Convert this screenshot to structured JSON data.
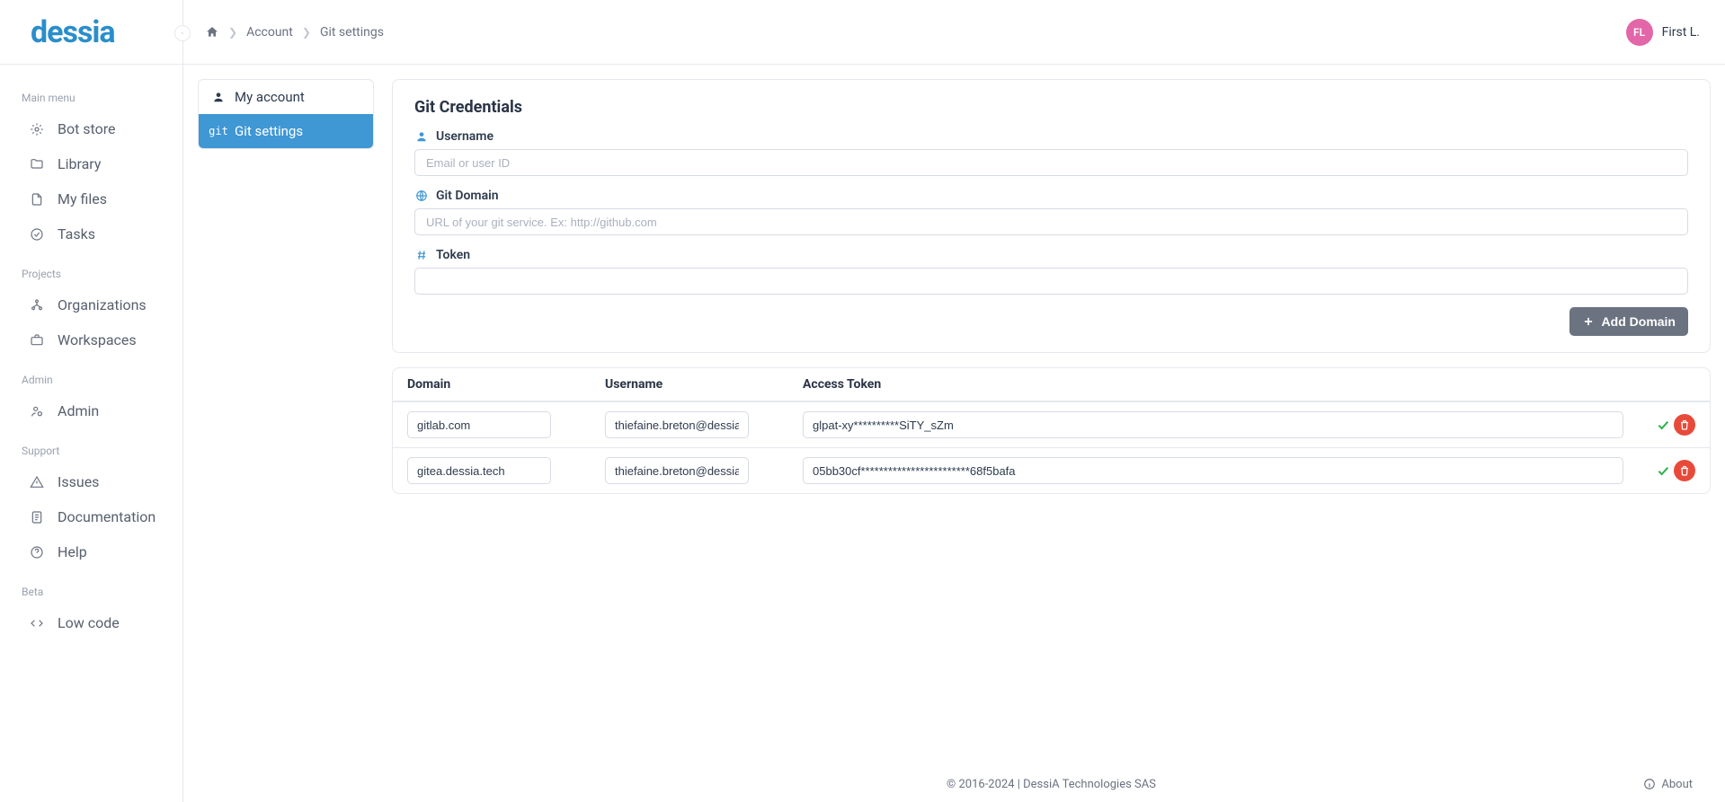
{
  "logo": "dessia",
  "breadcrumb": {
    "home_aria": "Home",
    "account": "Account",
    "git": "Git settings"
  },
  "user": {
    "initials": "FL",
    "display": "First L."
  },
  "sidebar": {
    "sections": [
      {
        "label": "Main menu",
        "items": [
          {
            "name": "bot-store",
            "label": "Bot store"
          },
          {
            "name": "library",
            "label": "Library"
          },
          {
            "name": "my-files",
            "label": "My files"
          },
          {
            "name": "tasks",
            "label": "Tasks"
          }
        ]
      },
      {
        "label": "Projects",
        "items": [
          {
            "name": "organizations",
            "label": "Organizations"
          },
          {
            "name": "workspaces",
            "label": "Workspaces"
          }
        ]
      },
      {
        "label": "Admin",
        "items": [
          {
            "name": "admin",
            "label": "Admin"
          }
        ]
      },
      {
        "label": "Support",
        "items": [
          {
            "name": "issues",
            "label": "Issues"
          },
          {
            "name": "documentation",
            "label": "Documentation"
          },
          {
            "name": "help",
            "label": "Help"
          }
        ]
      },
      {
        "label": "Beta",
        "items": [
          {
            "name": "low-code",
            "label": "Low code"
          }
        ]
      }
    ]
  },
  "settings_tabs": {
    "account": "My account",
    "git_prefix": "git",
    "git": "Git settings"
  },
  "form": {
    "title": "Git Credentials",
    "username_label": "Username",
    "username_placeholder": "Email or user ID",
    "domain_label": "Git Domain",
    "domain_placeholder": "URL of your git service. Ex: http://github.com",
    "token_label": "Token",
    "add_button": "Add Domain"
  },
  "table": {
    "headers": {
      "domain": "Domain",
      "username": "Username",
      "token": "Access Token"
    },
    "rows": [
      {
        "domain": "gitlab.com",
        "username": "thiefaine.breton@dessia.io",
        "token": "glpat-xy**********SiTY_sZm"
      },
      {
        "domain": "gitea.dessia.tech",
        "username": "thiefaine.breton@dessia.io",
        "token": "05bb30cf************************68f5bafa"
      }
    ]
  },
  "footer": {
    "copyright": "© 2016-2024 | DessiA Technologies SAS",
    "about": "About"
  }
}
